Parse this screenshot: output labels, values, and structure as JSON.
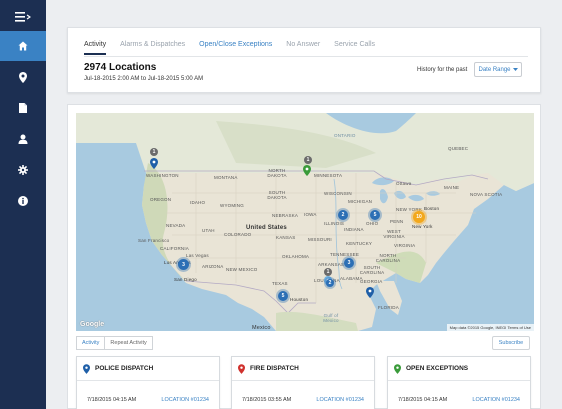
{
  "sidebar": {
    "items": [
      {
        "icon": "menu-icon"
      },
      {
        "icon": "home-icon",
        "active": true
      },
      {
        "icon": "map-pin-icon"
      },
      {
        "icon": "document-icon"
      },
      {
        "icon": "user-icon"
      },
      {
        "icon": "gear-icon"
      },
      {
        "icon": "info-icon"
      }
    ],
    "colors": {
      "background": "#1c2f52",
      "active": "#3a82c4"
    }
  },
  "header": {
    "tabs": [
      "Activity",
      "Alarms & Dispatches",
      "Open/Close Exceptions",
      "No Answer",
      "Service Calls"
    ],
    "active_tab": "Activity",
    "locations_title": "2974 Locations",
    "date_range_text": "Jul-18-2015 2:00 AM to Jul-18-2015 5:00 AM",
    "history_label": "History for the past",
    "date_range_button": "Date Range"
  },
  "map": {
    "country_label": "United States",
    "labels": [
      "WASHINGTON",
      "MONTANA",
      "NORTH DAKOTA",
      "MINNESOTA",
      "ONTARIO",
      "QUEBEC",
      "OREGON",
      "IDAHO",
      "WYOMING",
      "SOUTH DAKOTA",
      "WISCONSIN",
      "MICHIGAN",
      "Ottawa",
      "MAINE",
      "NOVA SCOTIA",
      "NEVADA",
      "UTAH",
      "COLORADO",
      "NEBRASKA",
      "IOWA",
      "ILLINOIS",
      "INDIANA",
      "OHIO",
      "PENN",
      "NEW YORK",
      "San Francisco",
      "Las Vegas",
      "KANSAS",
      "MISSOURI",
      "KENTUCKY",
      "WEST VIRGINIA",
      "VIRGINIA",
      "New York",
      "Boston",
      "CALIFORNIA",
      "Los Angeles",
      "ARIZONA",
      "NEW MEXICO",
      "OKLAHOMA",
      "ARKANSAS",
      "TENNESSEE",
      "NORTH CAROLINA",
      "SOUTH CAROLINA",
      "San Diego",
      "TEXAS",
      "LOUISIANA",
      "ALABAMA",
      "GEORGIA",
      "Houston",
      "FLORIDA",
      "Mexico",
      "Gulf of Mexico"
    ],
    "clusters": [
      {
        "count": "1",
        "color": "grey"
      },
      {
        "count": "1",
        "color": "grey"
      },
      {
        "count": "2",
        "color": "blue"
      },
      {
        "count": "5",
        "color": "blue"
      },
      {
        "count": "10",
        "color": "orange"
      },
      {
        "count": "3",
        "color": "blue"
      },
      {
        "count": "3",
        "color": "blue"
      },
      {
        "count": "5",
        "color": "blue"
      },
      {
        "count": "2",
        "color": "blue"
      },
      {
        "count": "1",
        "color": "grey"
      }
    ],
    "attribution": "Map data ©2015 Google, INEGI   Terms of Use",
    "google_logo": "Google"
  },
  "activity_tabs": [
    "Activity",
    "Repeat Activity"
  ],
  "subscribe_label": "Subscribe",
  "cards": [
    {
      "title": "POLICE DISPATCH",
      "time": "7/18/2015 04:15 AM",
      "location": "LOCATION #01234",
      "pin_color": "#1f5fa8"
    },
    {
      "title": "FIRE DISPATCH",
      "time": "7/18/2015 03:55 AM",
      "location": "LOCATION #01234",
      "pin_color": "#d0312d"
    },
    {
      "title": "OPEN EXCEPTIONS",
      "time": "7/18/2015 04:15 AM",
      "location": "LOCATION #01234",
      "pin_color": "#3a9b3a"
    }
  ]
}
